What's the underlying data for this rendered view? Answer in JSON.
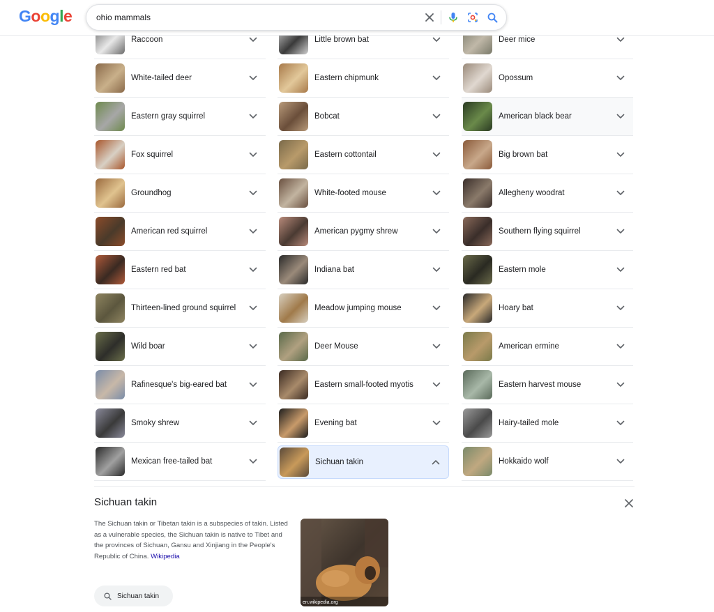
{
  "header": {
    "logo_letters": [
      {
        "ch": "G",
        "color": "#4285F4"
      },
      {
        "ch": "o",
        "color": "#EA4335"
      },
      {
        "ch": "o",
        "color": "#FBBC05"
      },
      {
        "ch": "g",
        "color": "#4285F4"
      },
      {
        "ch": "l",
        "color": "#34A853"
      },
      {
        "ch": "e",
        "color": "#EA4335"
      }
    ],
    "search": {
      "value": "ohio mammals"
    },
    "icons": [
      "close-icon",
      "mic-icon",
      "lens-icon",
      "search-icon"
    ]
  },
  "columns": [
    [
      {
        "name": "Raccoon",
        "thumb": [
          "#6b6b6b",
          "#e8e8e8"
        ]
      },
      {
        "name": "White-tailed deer",
        "thumb": [
          "#8a6a4a",
          "#c9b08a"
        ]
      },
      {
        "name": "Eastern gray squirrel",
        "thumb": [
          "#6e8a4e",
          "#a7a7a7"
        ]
      },
      {
        "name": "Fox squirrel",
        "thumb": [
          "#a8562c",
          "#d8d0c4"
        ]
      },
      {
        "name": "Groundhog",
        "thumb": [
          "#9a6a3e",
          "#e0c38f"
        ]
      },
      {
        "name": "American red squirrel",
        "thumb": [
          "#8c4c2a",
          "#4a3a2a"
        ]
      },
      {
        "name": "Eastern red bat",
        "thumb": [
          "#b05a3a",
          "#3a2a22"
        ]
      },
      {
        "name": "Thirteen-lined ground squirrel",
        "thumb": [
          "#8e8460",
          "#5c573e"
        ]
      },
      {
        "name": "Wild boar",
        "thumb": [
          "#6a6e4a",
          "#2e2e2a"
        ]
      },
      {
        "name": "Rafinesque's big-eared bat",
        "thumb": [
          "#7a8ca8",
          "#c8b8a8"
        ]
      },
      {
        "name": "Smoky shrew",
        "thumb": [
          "#8a8a9a",
          "#3a3a3a"
        ]
      },
      {
        "name": "Mexican free-tailed bat",
        "thumb": [
          "#2a2a2a",
          "#a0a0a0"
        ]
      }
    ],
    [
      {
        "name": "Little brown bat",
        "thumb": [
          "#cfcfcf",
          "#3a3a3a"
        ]
      },
      {
        "name": "Eastern chipmunk",
        "thumb": [
          "#a87a4a",
          "#e2c89a"
        ]
      },
      {
        "name": "Bobcat",
        "thumb": [
          "#b89a7a",
          "#6a4e3a"
        ]
      },
      {
        "name": "Eastern cottontail",
        "thumb": [
          "#7a6a4a",
          "#b89a6a"
        ]
      },
      {
        "name": "White-footed mouse",
        "thumb": [
          "#6a5040",
          "#c2b4a0"
        ]
      },
      {
        "name": "American pygmy shrew",
        "thumb": [
          "#b88a7a",
          "#4a3a32"
        ]
      },
      {
        "name": "Indiana bat",
        "thumb": [
          "#2a2a2a",
          "#9a8a7a"
        ]
      },
      {
        "name": "Meadow jumping mouse",
        "thumb": [
          "#d8d0c0",
          "#a07a4a"
        ]
      },
      {
        "name": "Deer Mouse",
        "thumb": [
          "#5a6a4a",
          "#b0a080"
        ]
      },
      {
        "name": "Eastern small-footed myotis",
        "thumb": [
          "#3a2a22",
          "#a88a6a"
        ]
      },
      {
        "name": "Evening bat",
        "thumb": [
          "#1e1e1e",
          "#c89a6a"
        ]
      },
      {
        "name": "Sichuan takin",
        "thumb": [
          "#5a4a3a",
          "#c89a5a"
        ]
      }
    ],
    [
      {
        "name": "Deer mice",
        "thumb": [
          "#7a7a6a",
          "#c0b8a8"
        ]
      },
      {
        "name": "Opossum",
        "thumb": [
          "#9a8a7a",
          "#e0d8d0"
        ]
      },
      {
        "name": "American black bear",
        "thumb": [
          "#2a3a22",
          "#6a8a4a"
        ]
      },
      {
        "name": "Big brown bat",
        "thumb": [
          "#8a5a3a",
          "#c8a88a"
        ]
      },
      {
        "name": "Allegheny woodrat",
        "thumb": [
          "#3a2e2a",
          "#8a7a6a"
        ]
      },
      {
        "name": "Southern flying squirrel",
        "thumb": [
          "#8a6a5a",
          "#3a2e2a"
        ]
      },
      {
        "name": "Eastern mole",
        "thumb": [
          "#6a6a4a",
          "#2a2a22"
        ]
      },
      {
        "name": "Hoary bat",
        "thumb": [
          "#2a2a2a",
          "#c8a87a"
        ]
      },
      {
        "name": "American ermine",
        "thumb": [
          "#7a7a4a",
          "#b89a6a"
        ]
      },
      {
        "name": "Eastern harvest mouse",
        "thumb": [
          "#5a6a5a",
          "#a8b8a8"
        ]
      },
      {
        "name": "Hairy-tailed mole",
        "thumb": [
          "#9a9a9a",
          "#4a4a4a"
        ]
      },
      {
        "name": "Hokkaido wolf",
        "thumb": [
          "#7a8a6a",
          "#c0a880"
        ]
      }
    ]
  ],
  "hover_item": {
    "column": 2,
    "row": 2
  },
  "active_item": {
    "column": 1,
    "row": 11
  },
  "detail": {
    "title": "Sichuan takin",
    "description": "The Sichuan takin or Tibetan takin is a subspecies of takin. Listed as a vulnerable species, the Sichuan takin is native to Tibet and the provinces of Sichuan, Gansu and Xinjiang in the People's Republic of China.",
    "link_text": "Wikipedia",
    "image_source": "en.wikipedia.org",
    "chip_label": "Sichuan takin"
  }
}
